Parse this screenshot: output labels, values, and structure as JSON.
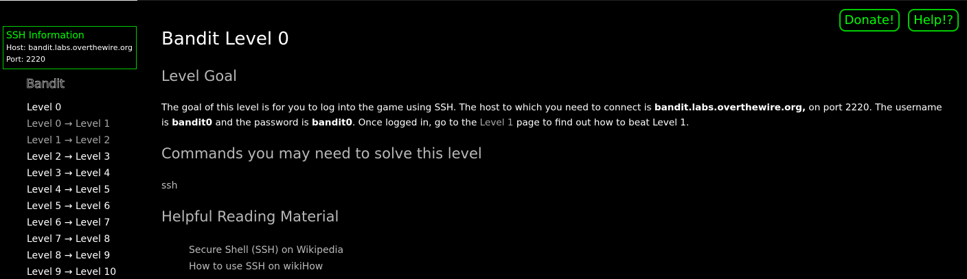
{
  "header": {
    "donate_label": "Donate!",
    "help_label": "Help!?"
  },
  "ssh_info": {
    "title": "SSH Information",
    "host": "Host: bandit.labs.overthewire.org",
    "port": "Port: 2220"
  },
  "sidebar": {
    "logo_text": "Bandit",
    "items": [
      {
        "label": "Level 0"
      },
      {
        "label": "Level 0 → Level 1"
      },
      {
        "label": "Level 1 → Level 2"
      },
      {
        "label": "Level 2 → Level 3"
      },
      {
        "label": "Level 3 → Level 4"
      },
      {
        "label": "Level 4 → Level 5"
      },
      {
        "label": "Level 5 → Level 6"
      },
      {
        "label": "Level 6 → Level 7"
      },
      {
        "label": "Level 7 → Level 8"
      },
      {
        "label": "Level 8 → Level 9"
      },
      {
        "label": "Level 9 → Level 10"
      }
    ]
  },
  "main": {
    "title": "Bandit Level 0",
    "level_goal_heading": "Level Goal",
    "goal_text": {
      "part1": "The goal of this level is for you to log into the game using SSH. The host to which you need to connect is ",
      "host": "bandit.labs.overthewire.org,",
      "part2": " on port 2220. The username is ",
      "username": "bandit0",
      "part3": " and the password is ",
      "password": "bandit0",
      "part4": ". Once logged in, go to the ",
      "link": "Level 1",
      "part5": " page to find out how to beat Level 1."
    },
    "commands_heading": "Commands you may need to solve this level",
    "command": "ssh",
    "reading_heading": "Helpful Reading Material",
    "reading_links": [
      {
        "label": "Secure Shell (SSH) on Wikipedia"
      },
      {
        "label": "How to use SSH on wikiHow"
      }
    ]
  },
  "colors": {
    "background": "#000000",
    "accent_green": "#00ff00",
    "text": "#ffffff",
    "muted": "#bbbbbb"
  }
}
